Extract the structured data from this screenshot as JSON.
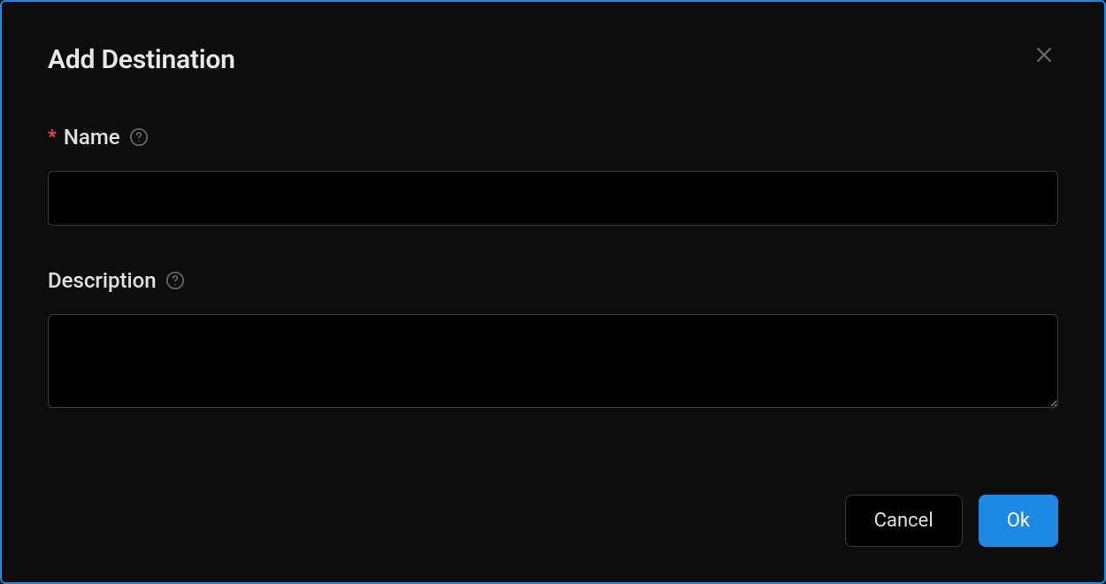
{
  "modal": {
    "title": "Add Destination",
    "fields": {
      "name": {
        "label": "Name",
        "required": true,
        "value": ""
      },
      "description": {
        "label": "Description",
        "required": false,
        "value": ""
      }
    },
    "buttons": {
      "cancel": "Cancel",
      "ok": "Ok"
    }
  }
}
